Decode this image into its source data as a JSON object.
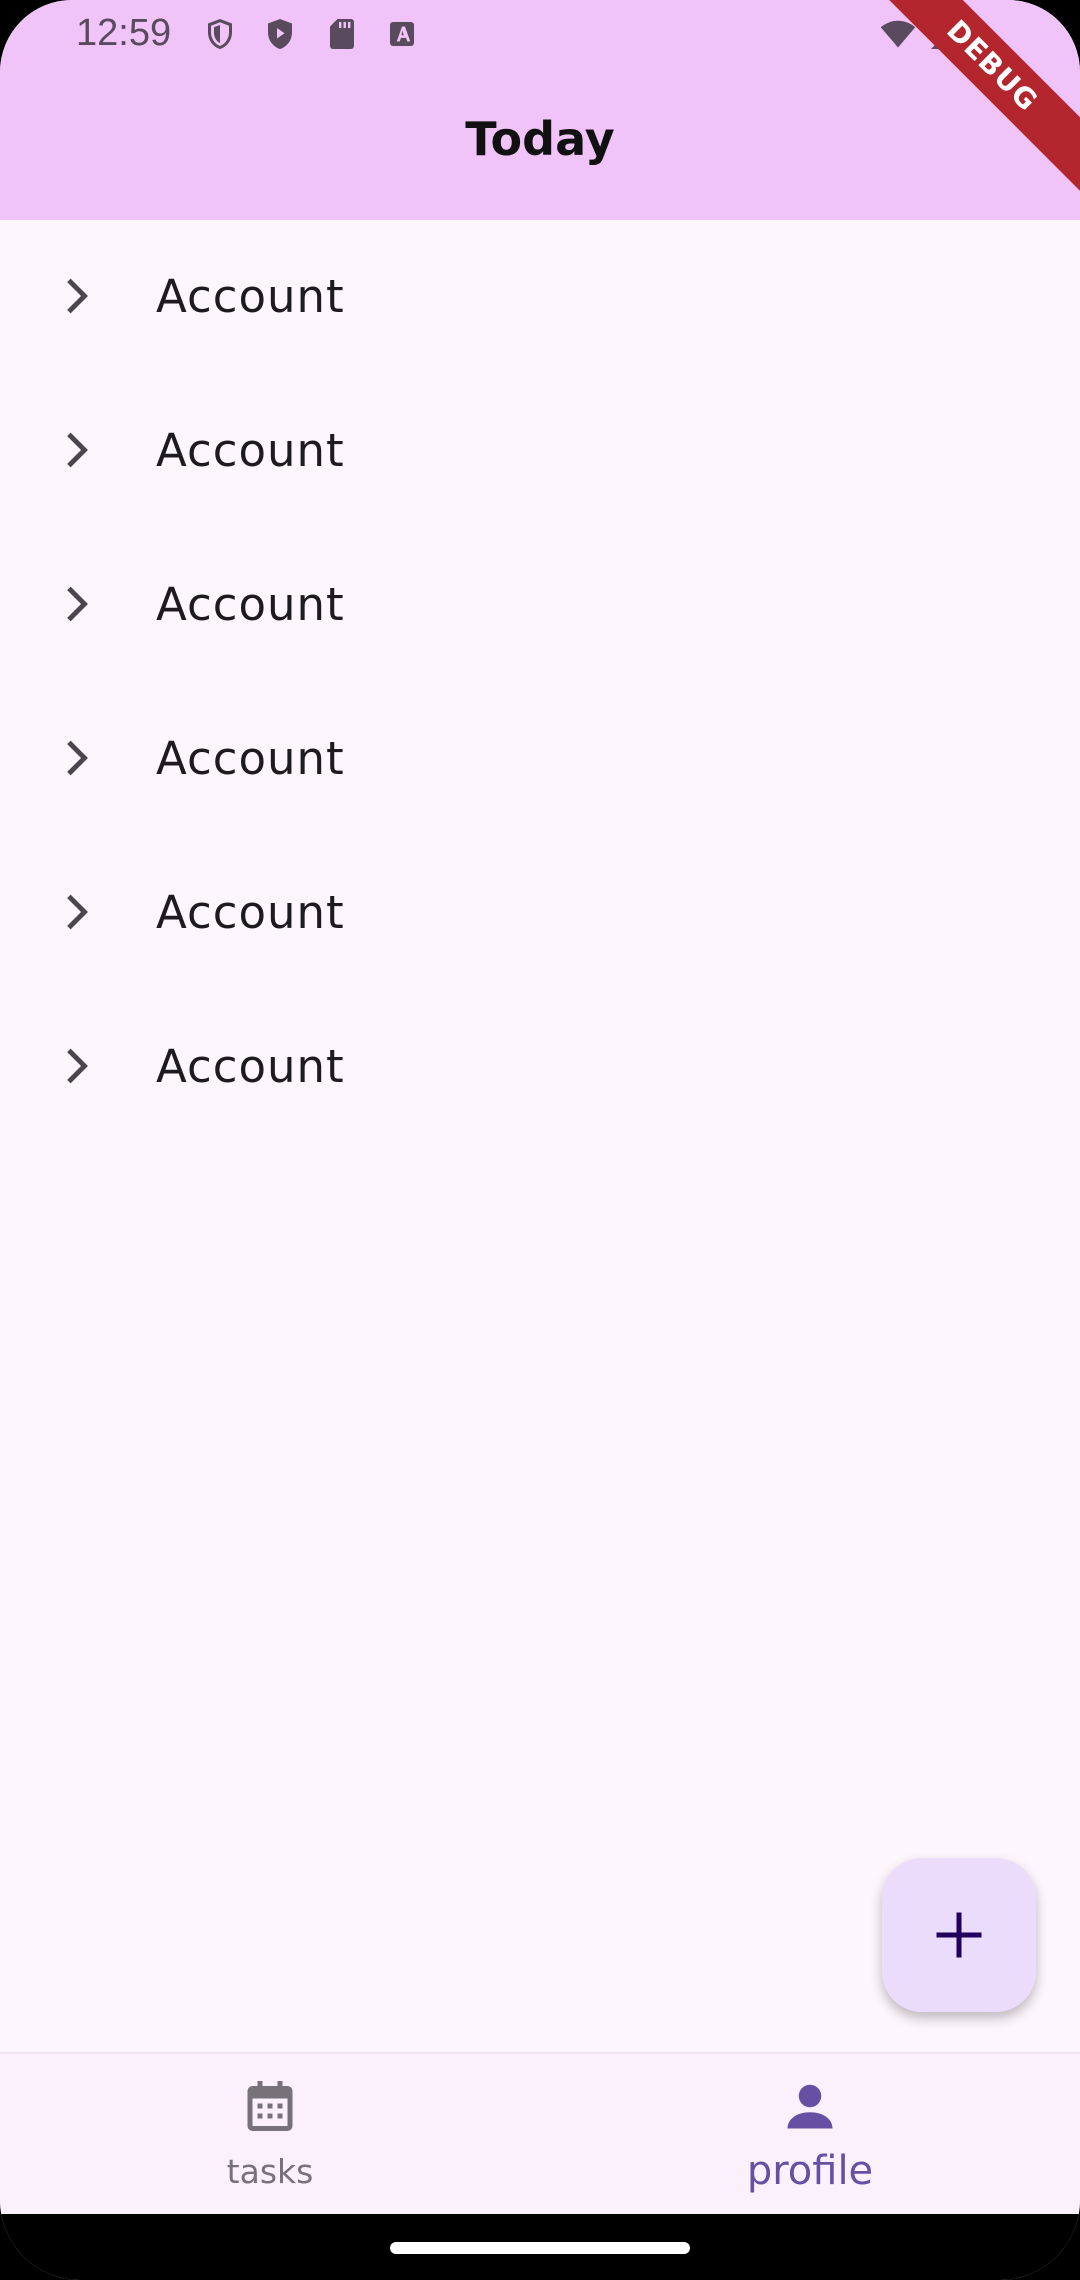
{
  "status_bar": {
    "time": "12:59",
    "left_icons": [
      "shield-outline-icon",
      "shield-play-icon",
      "sd-card-icon",
      "text-a-icon"
    ],
    "right_icons": [
      "wifi-icon",
      "cellular-signal-icon"
    ]
  },
  "debug_banner": {
    "label": "DEBUG"
  },
  "app_bar": {
    "title": "Today",
    "color": "#f0c4f8"
  },
  "list": {
    "items": [
      {
        "label": "Account",
        "icon": "chevron-right-icon"
      },
      {
        "label": "Account",
        "icon": "chevron-right-icon"
      },
      {
        "label": "Account",
        "icon": "chevron-right-icon"
      },
      {
        "label": "Account",
        "icon": "chevron-right-icon"
      },
      {
        "label": "Account",
        "icon": "chevron-right-icon"
      },
      {
        "label": "Account",
        "icon": "chevron-right-icon"
      }
    ]
  },
  "fab": {
    "icon": "plus-icon",
    "color": "#ecdcfb"
  },
  "bottom_nav": {
    "items": [
      {
        "label": "tasks",
        "icon": "calendar-icon",
        "selected": false
      },
      {
        "label": "profile",
        "icon": "person-icon",
        "selected": true
      }
    ],
    "accent_color": "#6750a4"
  }
}
